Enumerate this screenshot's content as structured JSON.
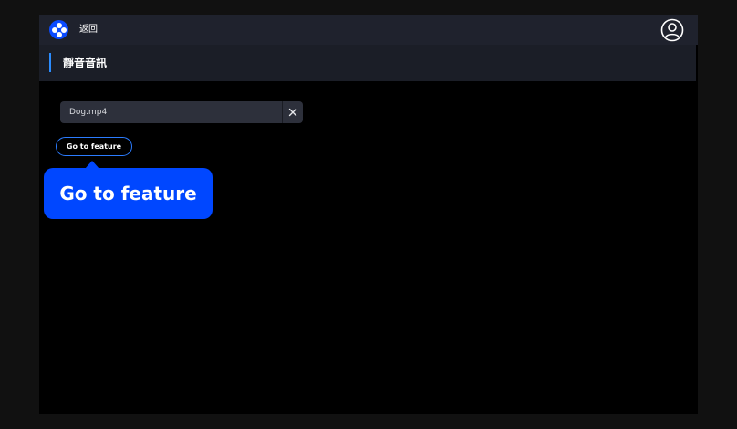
{
  "topbar": {
    "logo_icon": "app-logo-icon",
    "back_label": "返回",
    "account_icon": "user-account-icon"
  },
  "header": {
    "title": "靜音音訊"
  },
  "file": {
    "name": "Dog.mp4",
    "remove_icon": "close-icon"
  },
  "feature_button": {
    "label": "Go to feature"
  },
  "tooltip": {
    "text": "Go to feature"
  },
  "colors": {
    "accent": "#0047ff",
    "outline": "#2b7cff",
    "topbar_bg": "#1f222d",
    "header_bg": "#1b1e27",
    "chip_bg": "#2d303b"
  }
}
